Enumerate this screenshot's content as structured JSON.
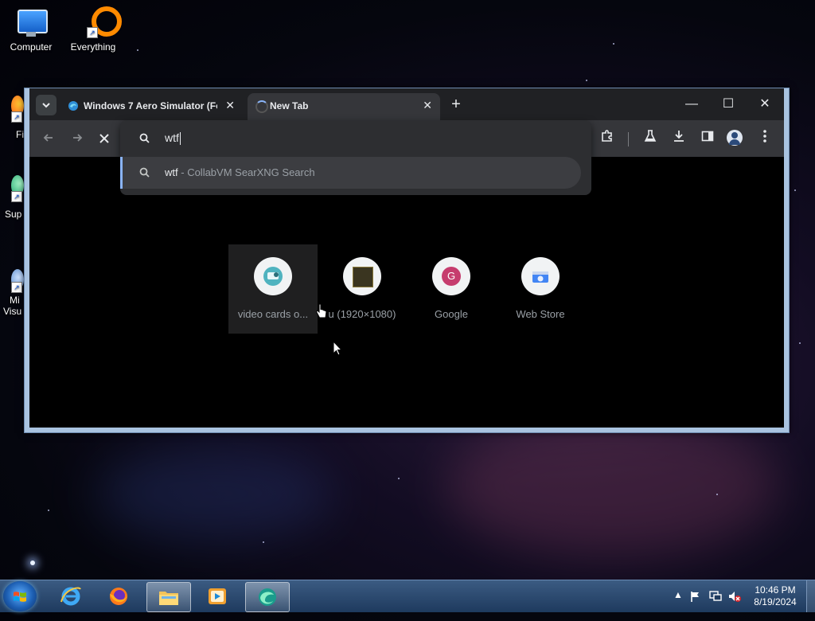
{
  "desktop": {
    "icons": [
      {
        "label": "Computer"
      },
      {
        "label": "Everything"
      },
      {
        "label": "Fi"
      },
      {
        "label": "Sup"
      },
      {
        "label": "Mi"
      },
      {
        "label": "Visu"
      }
    ]
  },
  "browser": {
    "tabs": [
      {
        "title": "Windows 7 Aero Simulator (Fo",
        "close": "✕"
      },
      {
        "title": "New Tab",
        "close": "✕"
      }
    ],
    "new_tab_symbol": "+",
    "window_controls": {
      "minimize": "—",
      "maximize": "☐",
      "close": "✕"
    },
    "omnibox": {
      "value": "wtf",
      "suggestion": {
        "query": "wtf",
        "separator": " - ",
        "source": "CollabVM SearXNG Search"
      }
    },
    "shortcuts": [
      {
        "label": "video cards o..."
      },
      {
        "label": "u (1920×1080)"
      },
      {
        "label": "Google",
        "letter": "G"
      },
      {
        "label": "Web Store"
      }
    ]
  },
  "taskbar": {
    "clock": {
      "time": "10:46 PM",
      "date": "8/19/2024"
    },
    "tray_arrow": "▲"
  }
}
